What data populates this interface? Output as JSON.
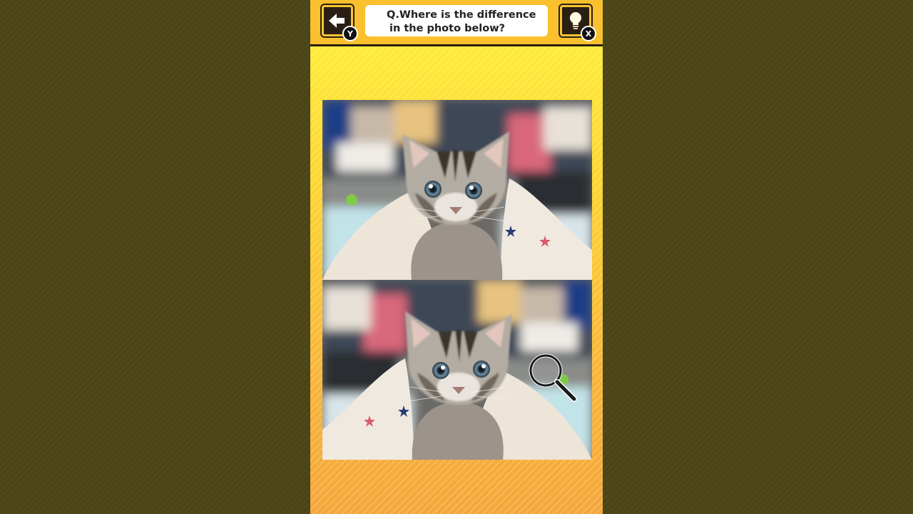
{
  "header": {
    "question_line1": "Q.Where is the difference",
    "question_line2": "in the photo below?",
    "back_key": "Y",
    "hint_key": "X"
  },
  "icons": {
    "back": "arrow-left-icon",
    "hint": "lightbulb-icon",
    "cursor": "magnifier-icon"
  },
  "colors": {
    "header": "#fbc02d",
    "button_bg": "#2b1f15",
    "backdrop": "#4a4416"
  }
}
